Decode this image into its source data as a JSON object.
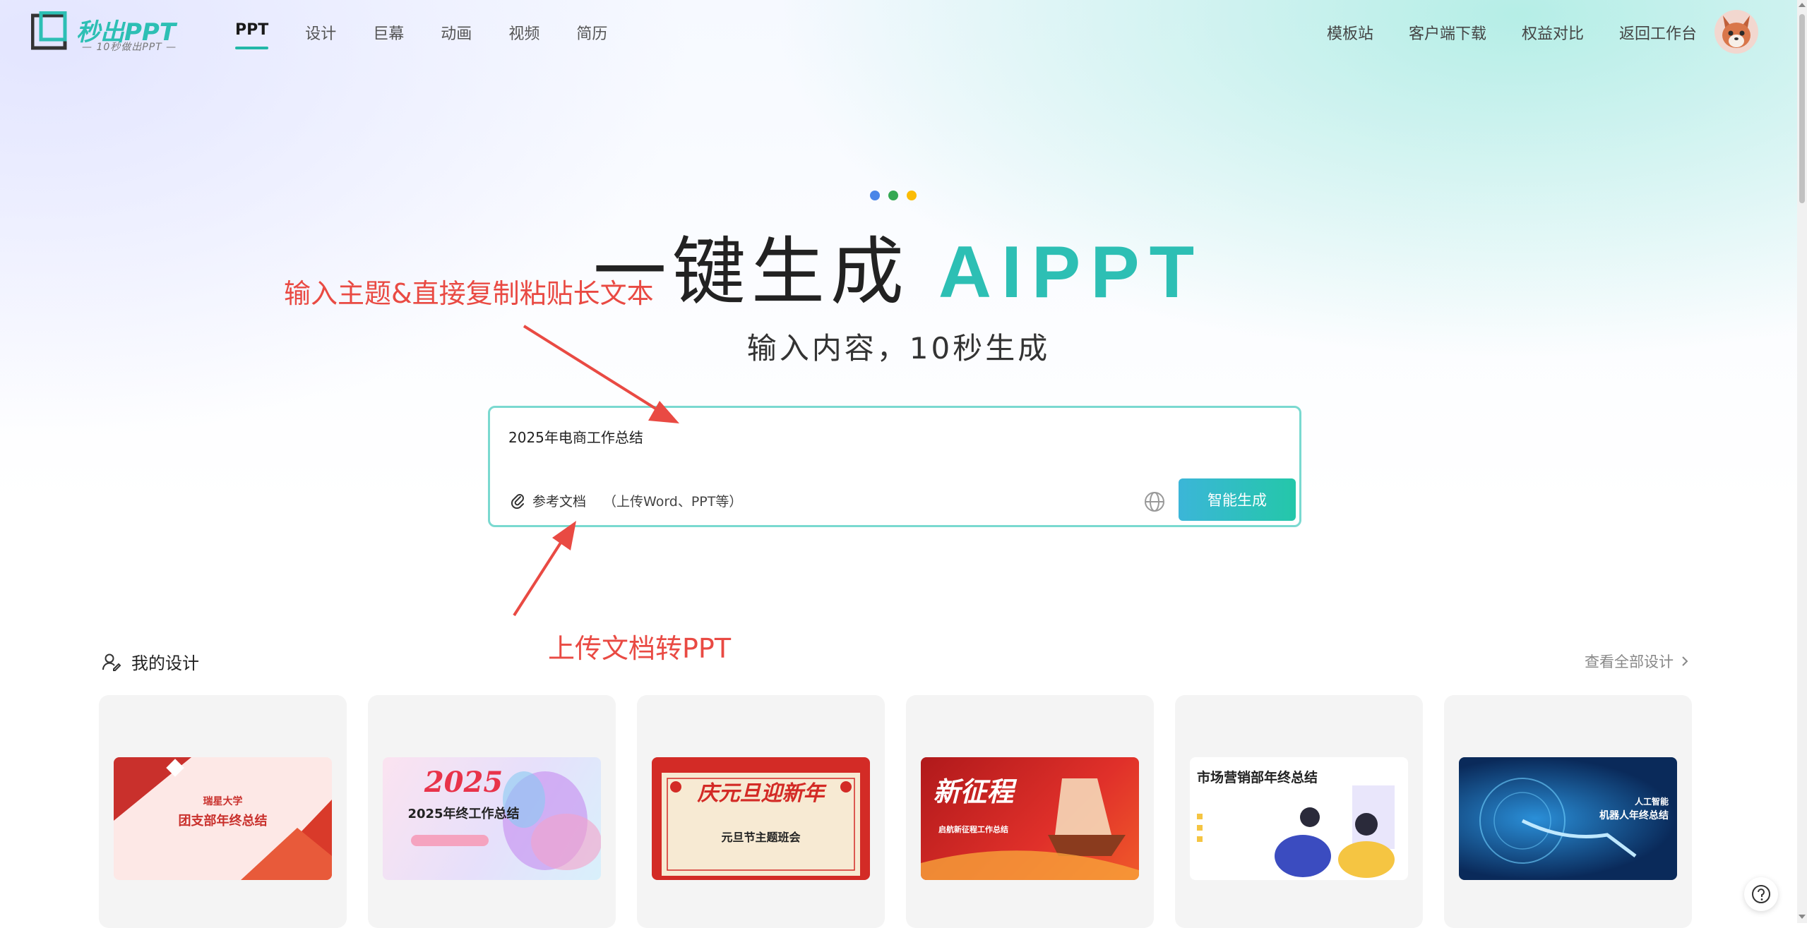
{
  "brand": {
    "name": "秒出PPT",
    "tagline": "— 10秒做出PPT —"
  },
  "nav": {
    "items": [
      "PPT",
      "设计",
      "巨幕",
      "动画",
      "视频",
      "简历"
    ],
    "active": "PPT"
  },
  "right_nav": [
    "模板站",
    "客户端下载",
    "权益对比",
    "返回工作台"
  ],
  "hero": {
    "title_main": "一键生成",
    "title_accent": "AIPPT",
    "subtitle": "输入内容，10秒生成"
  },
  "input": {
    "value": "2025年电商工作总结",
    "attach_label": "参考文档",
    "attach_hint": "（上传Word、PPT等）",
    "generate_label": "智能生成"
  },
  "annotations": {
    "top": "输入主题&直接复制粘贴长文本",
    "bottom": "上传文档转PPT"
  },
  "my_designs": {
    "title": "我的设计",
    "view_all": "查看全部设计",
    "cards": [
      {
        "title": "团支部年终总结",
        "subtitle": "瑞星大学"
      },
      {
        "title": "2025年终工作总结",
        "subtitle": "2025"
      },
      {
        "title": "元旦节主题班会",
        "subtitle": "庆元旦迎新年"
      },
      {
        "title": "新征程",
        "subtitle": "启航新征程工作总结"
      },
      {
        "title": "市场营销部年终总结",
        "subtitle": ""
      },
      {
        "title": "机器人年终总结",
        "subtitle": "人工智能"
      }
    ]
  },
  "colors": {
    "accent": "#2dbfb4",
    "annotation": "#e94a43",
    "button_start": "#3bb6d8",
    "button_end": "#24c7a9"
  }
}
